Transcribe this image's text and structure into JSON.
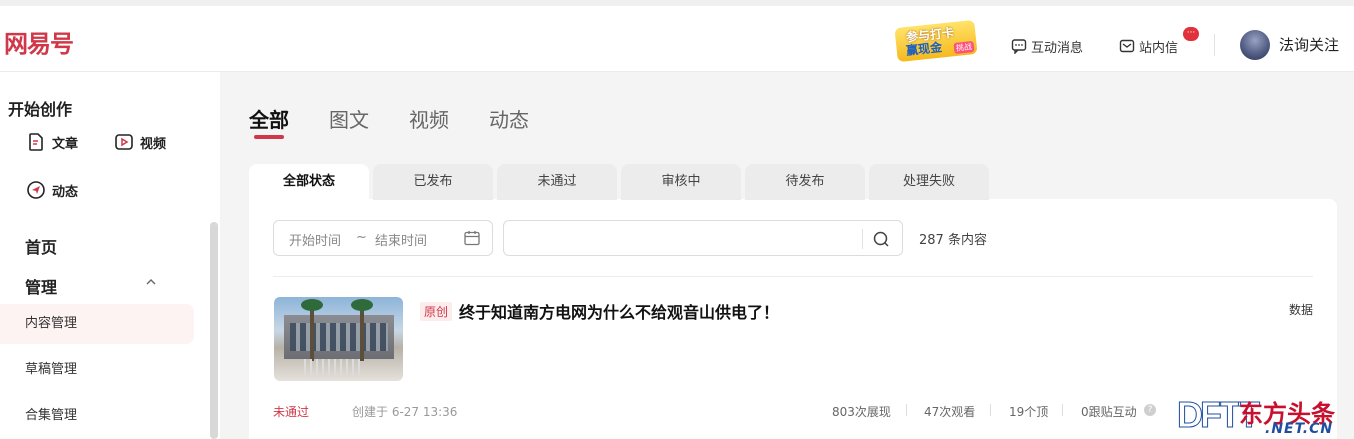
{
  "header": {
    "logo": "网易号",
    "promo": {
      "line1": "参与打卡",
      "line2": "赢现金",
      "tag": "挑战"
    },
    "interaction_msg": "互动消息",
    "inbox": "站内信",
    "inbox_badge": "···",
    "username": "法询关注"
  },
  "sidebar": {
    "create_title": "开始创作",
    "create_items": [
      "文章",
      "视频",
      "动态"
    ],
    "home": "首页",
    "manage": "管理",
    "items": [
      "内容管理",
      "草稿管理",
      "合集管理"
    ]
  },
  "main": {
    "tabs": [
      "全部",
      "图文",
      "视频",
      "动态"
    ],
    "sub_tabs": [
      "全部状态",
      "已发布",
      "未通过",
      "审核中",
      "待发布",
      "处理失败"
    ],
    "date_start_placeholder": "开始时间",
    "date_tilde": "~",
    "date_end_placeholder": "结束时间",
    "count": "287 条内容"
  },
  "article": {
    "badge": "原创",
    "title": "终于知道南方电网为什么不给观音山供电了！",
    "data_link": "数据",
    "status": "未通过",
    "created": "创建于 6-27 13:36",
    "stats": [
      "803次展现",
      "47次观看",
      "19个顶",
      "0跟贴互动"
    ],
    "help": "?"
  },
  "watermark": {
    "latin": "DFTT",
    "cn": "东方头条",
    "domain": ".NET.CN"
  },
  "colors": {
    "brand": "#d0384a",
    "badge": "#e0313d"
  }
}
